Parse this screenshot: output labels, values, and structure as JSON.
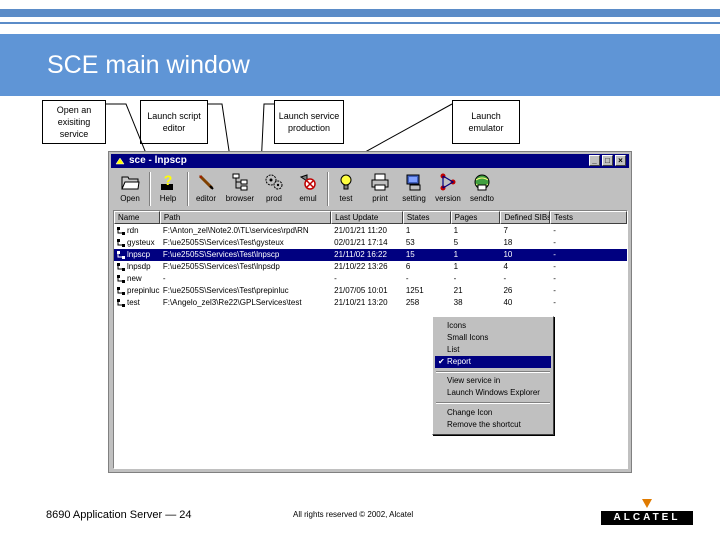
{
  "slide": {
    "title": "SCE main window",
    "footer_left": "8690 Application Server — 24",
    "footer_center": "All rights reserved © 2002, Alcatel",
    "logo_text": "ALCATEL"
  },
  "callouts": [
    {
      "text": "Open an exisiting service"
    },
    {
      "text": "Launch script editor"
    },
    {
      "text": "Launch service production"
    },
    {
      "text": "Launch emulator"
    }
  ],
  "window": {
    "title": "sce - lnpscp",
    "buttons": [
      "_",
      "□",
      "×"
    ]
  },
  "toolbar": [
    {
      "label": "Open",
      "icon": "open-folder-icon"
    },
    {
      "label": "Help",
      "icon": "help-icon"
    },
    {
      "label": "editor",
      "icon": "editor-icon"
    },
    {
      "label": "browser",
      "icon": "browser-icon"
    },
    {
      "label": "prod",
      "icon": "prod-icon"
    },
    {
      "label": "emul",
      "icon": "emul-icon"
    },
    {
      "label": "test",
      "icon": "test-icon"
    },
    {
      "label": "print",
      "icon": "print-icon"
    },
    {
      "label": "setting",
      "icon": "setting-icon"
    },
    {
      "label": "version",
      "icon": "version-icon"
    },
    {
      "label": "sendto",
      "icon": "sendto-icon"
    }
  ],
  "table": {
    "columns": [
      "Name",
      "Path",
      "Last Update",
      "States",
      "Pages",
      "Defined SIBs",
      "Tests"
    ],
    "rows": [
      {
        "name": "rdn",
        "path": "F:\\Anton_zel\\Note2.0\\TL\\services\\rpd\\RN",
        "last_update": "21/01/21 11:20",
        "states": "1",
        "pages": "1",
        "sibs": "7",
        "tests": "-"
      },
      {
        "name": "gysteux",
        "path": "F:\\ue2505S\\Services\\Test\\gysteux",
        "last_update": "02/01/21 17:14",
        "states": "53",
        "pages": "5",
        "sibs": "18",
        "tests": "-"
      },
      {
        "name": "lnpscp",
        "path": "F:\\ue2505S\\Services\\Test\\lnpscp",
        "last_update": "21/11/02 16:22",
        "states": "15",
        "pages": "1",
        "sibs": "10",
        "tests": "-"
      },
      {
        "name": "lnpsdp",
        "path": "F:\\ue2505S\\Services\\Test\\lnpsdp",
        "last_update": "21/10/22 13:26",
        "states": "6",
        "pages": "1",
        "sibs": "4",
        "tests": "-"
      },
      {
        "name": "new",
        "path": "-",
        "last_update": "-",
        "states": "-",
        "pages": "-",
        "sibs": "-",
        "tests": "-"
      },
      {
        "name": "prepinluc",
        "path": "F:\\ue2505S\\Services\\Test\\prepinluc",
        "last_update": "21/07/05 10:01",
        "states": "1251",
        "pages": "21",
        "sibs": "26",
        "tests": "-"
      },
      {
        "name": "test",
        "path": "F:\\Angelo_zel3\\Re22\\GPLServices\\test",
        "last_update": "21/10/21 13:20",
        "states": "258",
        "pages": "38",
        "sibs": "40",
        "tests": "-"
      }
    ],
    "selected_index": 2
  },
  "context_menu": {
    "items": [
      {
        "label": "Icons",
        "checked": false
      },
      {
        "label": "Small Icons",
        "checked": false
      },
      {
        "label": "List",
        "checked": false
      },
      {
        "label": "Report",
        "checked": true
      },
      {
        "label": "View service in",
        "checked": false
      },
      {
        "label": "Launch Windows Explorer",
        "checked": false
      },
      {
        "label": "Change Icon",
        "checked": false
      },
      {
        "label": "Remove the shortcut",
        "checked": false
      }
    ]
  },
  "colors": {
    "title_band": "#5f95d6",
    "window_titlebar": "#000080",
    "selection": "#000080",
    "logo_accent": "#e07b00"
  }
}
